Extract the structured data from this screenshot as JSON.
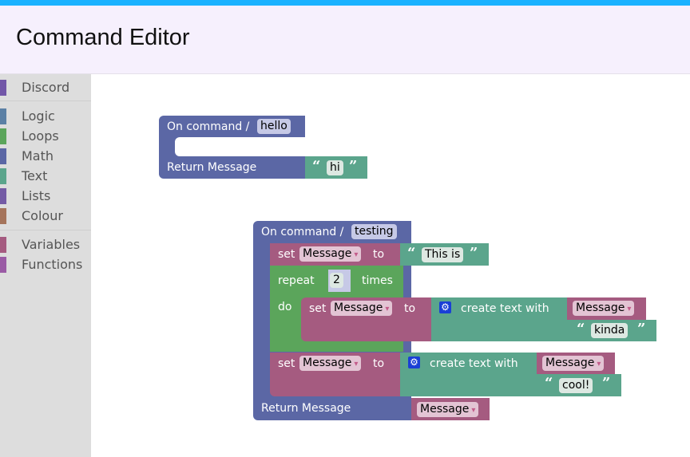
{
  "header": {
    "title": "Command Editor"
  },
  "toolbox": {
    "items": [
      {
        "label": "Discord",
        "color": "#7257a8"
      },
      {
        "label": "Logic",
        "color": "#5b80a5"
      },
      {
        "label": "Loops",
        "color": "#5ba55b"
      },
      {
        "label": "Math",
        "color": "#5b67a5"
      },
      {
        "label": "Text",
        "color": "#5ba58c"
      },
      {
        "label": "Lists",
        "color": "#745ba5"
      },
      {
        "label": "Colour",
        "color": "#a5745b"
      },
      {
        "label": "Variables",
        "color": "#a55b80"
      },
      {
        "label": "Functions",
        "color": "#9a5ba5"
      }
    ]
  },
  "blocks": {
    "cmd1": {
      "prefix": "On command /",
      "name": "hello",
      "return_label": "Return Message",
      "return_text": "hi"
    },
    "cmd2": {
      "prefix": "On command /",
      "name": "testing",
      "set1": {
        "set": "set",
        "var": "Message",
        "to": "to",
        "text": "This is"
      },
      "repeat": {
        "label": "repeat",
        "count": "2",
        "times": "times",
        "do": "do"
      },
      "set2": {
        "set": "set",
        "var": "Message",
        "to": "to",
        "create": "create text with",
        "item1_var": "Message",
        "item2_text": "kinda"
      },
      "set3": {
        "set": "set",
        "var": "Message",
        "to": "to",
        "create": "create text with",
        "item1_var": "Message",
        "item2_text": "cool!"
      },
      "return_label": "Return Message",
      "return_var": "Message"
    }
  },
  "glyphs": {
    "open_quote": "“",
    "close_quote": "”",
    "dropdown": "▾",
    "gear": "⚙"
  },
  "colors": {
    "event": "#5b67a5",
    "loops": "#5ba55b",
    "variables": "#a55b80",
    "text": "#5ba58c",
    "topbar": "#1ab2ff"
  }
}
